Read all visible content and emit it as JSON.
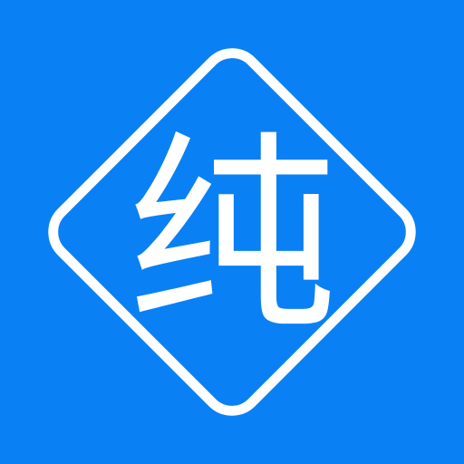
{
  "app_icon": {
    "glyph": "纯",
    "background_color": "#0A80F5",
    "foreground_color": "#FFFFFF",
    "frame_shape": "rounded-diamond-outline"
  }
}
